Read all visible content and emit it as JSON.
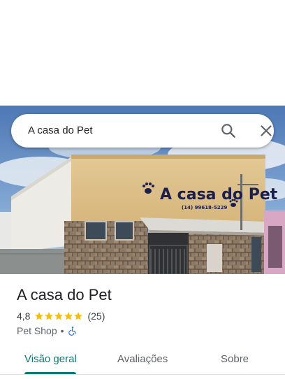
{
  "search": {
    "query": "A casa do Pet",
    "search_icon": "search-icon",
    "close_icon": "close-icon"
  },
  "hero": {
    "sign_text": "A casa do Pet",
    "sign_phone": "(14) 99618-5229"
  },
  "place": {
    "name": "A casa do Pet",
    "rating": "4,8",
    "stars": 5,
    "reviews": "(25)",
    "category": "Pet Shop",
    "separator": "•",
    "accessibility_icon": "wheelchair-icon"
  },
  "tabs": [
    {
      "label": "Visão geral",
      "active": true
    },
    {
      "label": "Avaliações",
      "active": false
    },
    {
      "label": "Sobre",
      "active": false
    }
  ],
  "colors": {
    "accent": "#0b7a75",
    "star": "#fbbc04",
    "accessibility": "#1a73e8"
  }
}
